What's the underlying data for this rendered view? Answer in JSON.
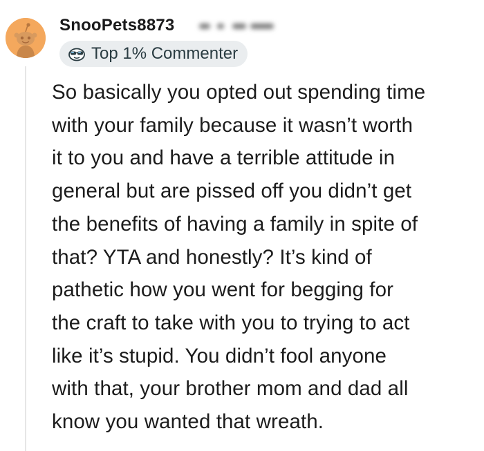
{
  "comment": {
    "username": "SnooPets8873",
    "badge_label": "Top 1% Commenter",
    "avatar_icon": "snoo-avatar-icon",
    "badge_icon": "sunglasses-snoo-icon",
    "body_lines": [
      "So basically you opted out spending time",
      "with your family because it wasn’t worth",
      "it to you and have a terrible attitude in",
      "general but are pissed off you didn’t get",
      "the benefits of having a family in spite of",
      "that? YTA and honestly? It’s kind of",
      "pathetic how you went for begging for",
      "the craft to take with you to trying to act",
      "like it’s stupid. You didn’t fool anyone",
      "with that, your brother mom and dad all",
      "know you wanted that wreath."
    ]
  },
  "colors": {
    "avatar_bg": "#f4a85d",
    "badge_bg": "#eaedef",
    "thread_line": "#e6e6e6",
    "text": "#1c1c1c"
  }
}
